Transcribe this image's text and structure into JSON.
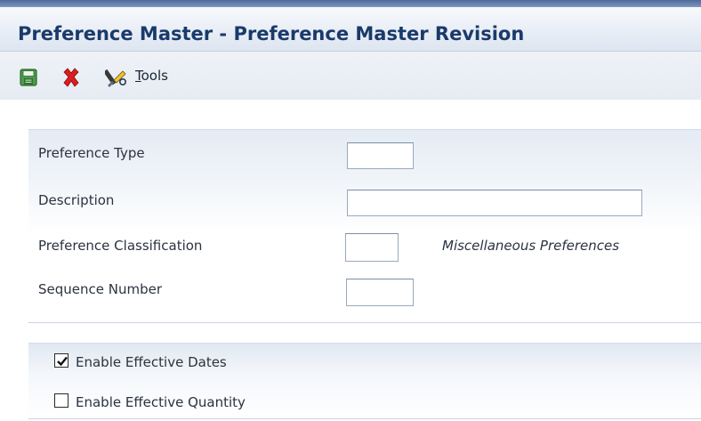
{
  "window": {
    "title": "Preference Master - Preference Master Revision"
  },
  "toolbar": {
    "save_icon": "save-icon",
    "cancel_icon": "cancel-icon",
    "tools_icon": "tools-icon",
    "tools_label_first": "T",
    "tools_label_rest": "ools"
  },
  "form": {
    "preference_type": {
      "label": "Preference Type",
      "value": ""
    },
    "description": {
      "label": "Description",
      "value": ""
    },
    "preference_classification": {
      "label": "Preference Classification",
      "value": "",
      "description": "Miscellaneous Preferences"
    },
    "sequence_number": {
      "label": "Sequence Number",
      "value": ""
    }
  },
  "options": {
    "effective_dates": {
      "label": "Enable Effective Dates",
      "checked": true
    },
    "effective_quantity": {
      "label": "Enable Effective Quantity",
      "checked": false
    }
  },
  "colors": {
    "title": "#1a3a6b",
    "cancel_red": "#d81e1e",
    "save_green": "#3a8a3a"
  }
}
